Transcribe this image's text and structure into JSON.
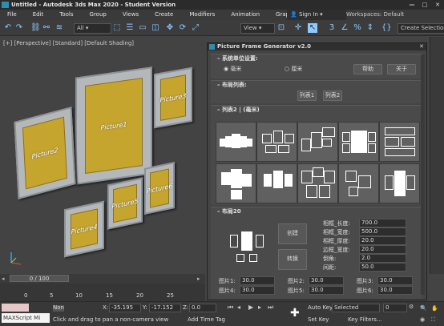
{
  "app": {
    "title": "Untitled - Autodesk 3ds Max 2020 - Student Version",
    "win_min": "—",
    "win_max": "□",
    "win_close": "✕"
  },
  "menu": {
    "items": [
      "File",
      "Edit",
      "Tools",
      "Group",
      "Views",
      "Create",
      "Modifiers",
      "Animation",
      "Graph Editors"
    ],
    "signin": "Sign In",
    "workspace_label": "Workspaces:",
    "workspace_value": "Default"
  },
  "toolbar": {
    "filter": "All",
    "view": "View",
    "create_selection": "Create Selection S"
  },
  "viewport": {
    "label": "[+] [Perspective] [Standard] [Default Shading]",
    "pictures": [
      "Picture1",
      "Picture2",
      "Picture3",
      "Picture4",
      "Picture5",
      "Picture6"
    ]
  },
  "timeline": {
    "frame": "0 / 100",
    "ticks": [
      "0",
      "5",
      "10",
      "15",
      "20",
      "25"
    ]
  },
  "status": {
    "maxscript": "MAXScript Mi",
    "none": "Non",
    "prompt": "Click and drag to pan a non-camera view",
    "x_label": "X:",
    "x_val": "-35.195",
    "y_label": "Y:",
    "y_val": "-17.152",
    "z_label": "Z:",
    "z_val": "0.0",
    "add_time_tag": "Add Time Tag",
    "auto_key": "Auto Key",
    "set_key": "Set Key",
    "selected": "Selected",
    "key_filters": "Key Filters...",
    "frame_num": "0"
  },
  "panel": {
    "title": "Picture Frame Generator v2.0",
    "sec_unit": {
      "head": "系统单位设置:",
      "mm": "毫米",
      "m": "厘米",
      "help": "帮助",
      "about": "关于"
    },
    "sec_list": {
      "head": "布局列表:",
      "btn1": "列表1",
      "btn2": "列表2"
    },
    "sec_layouts": {
      "head": "列表2 | (毫米)"
    },
    "sec_layout20": {
      "head": "布局20",
      "create": "创建",
      "convert": "转换",
      "params": [
        {
          "label": "相框_长度:",
          "value": "700.0"
        },
        {
          "label": "相框_宽度:",
          "value": "500.0"
        },
        {
          "label": "相框_厚度:",
          "value": "20.0"
        },
        {
          "label": "边框_宽度:",
          "value": "20.0"
        },
        {
          "label": "倒角:",
          "value": "2.0"
        },
        {
          "label": "间距:",
          "value": "50.0"
        }
      ],
      "spacing": [
        {
          "label": "图片1:",
          "value": "30.0"
        },
        {
          "label": "图片2:",
          "value": "30.0"
        },
        {
          "label": "图片3:",
          "value": "30.0"
        },
        {
          "label": "图片4:",
          "value": "30.0"
        },
        {
          "label": "图片5:",
          "value": "30.0"
        },
        {
          "label": "图片6:",
          "value": "30.0"
        }
      ]
    }
  },
  "colors": {
    "accent": "#2b8fae",
    "frame": "#b5b8bb",
    "picture": "#c6a52e"
  }
}
